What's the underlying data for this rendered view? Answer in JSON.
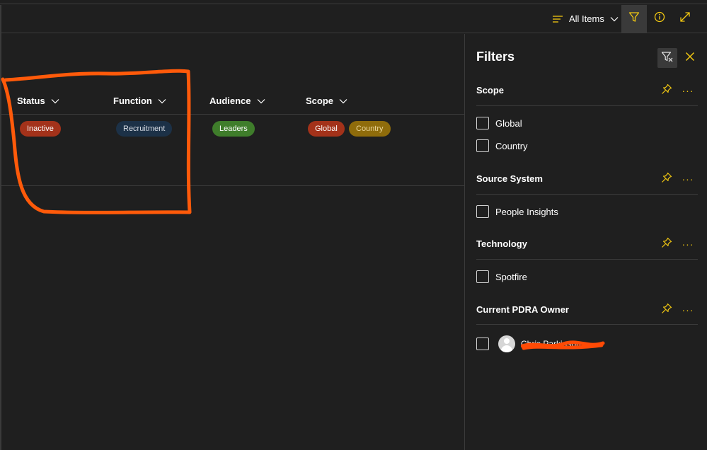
{
  "command_bar": {
    "view_label": "All Items"
  },
  "grid": {
    "columns": [
      {
        "label": "Status"
      },
      {
        "label": "Function"
      },
      {
        "label": "Audience"
      },
      {
        "label": "Scope"
      }
    ],
    "row": {
      "status": "Inactive",
      "function": "Recruitment",
      "audience": "Leaders",
      "scope": [
        "Global",
        "Country"
      ]
    }
  },
  "filters": {
    "title": "Filters",
    "groups": [
      {
        "title": "Scope",
        "options": [
          "Global",
          "Country"
        ]
      },
      {
        "title": "Source System",
        "options": [
          "People Insights"
        ]
      },
      {
        "title": "Technology",
        "options": [
          "Spotfire"
        ]
      },
      {
        "title": "Current PDRA Owner",
        "options": [
          "Chris Parkinson"
        ]
      }
    ]
  },
  "colors": {
    "accent": "#f2c811",
    "annotation": "#ff5a0a",
    "pill_red": "#a3321a",
    "pill_navy": "#1c3147",
    "pill_green": "#3f7d2b",
    "pill_gold": "#8f6c0b"
  }
}
